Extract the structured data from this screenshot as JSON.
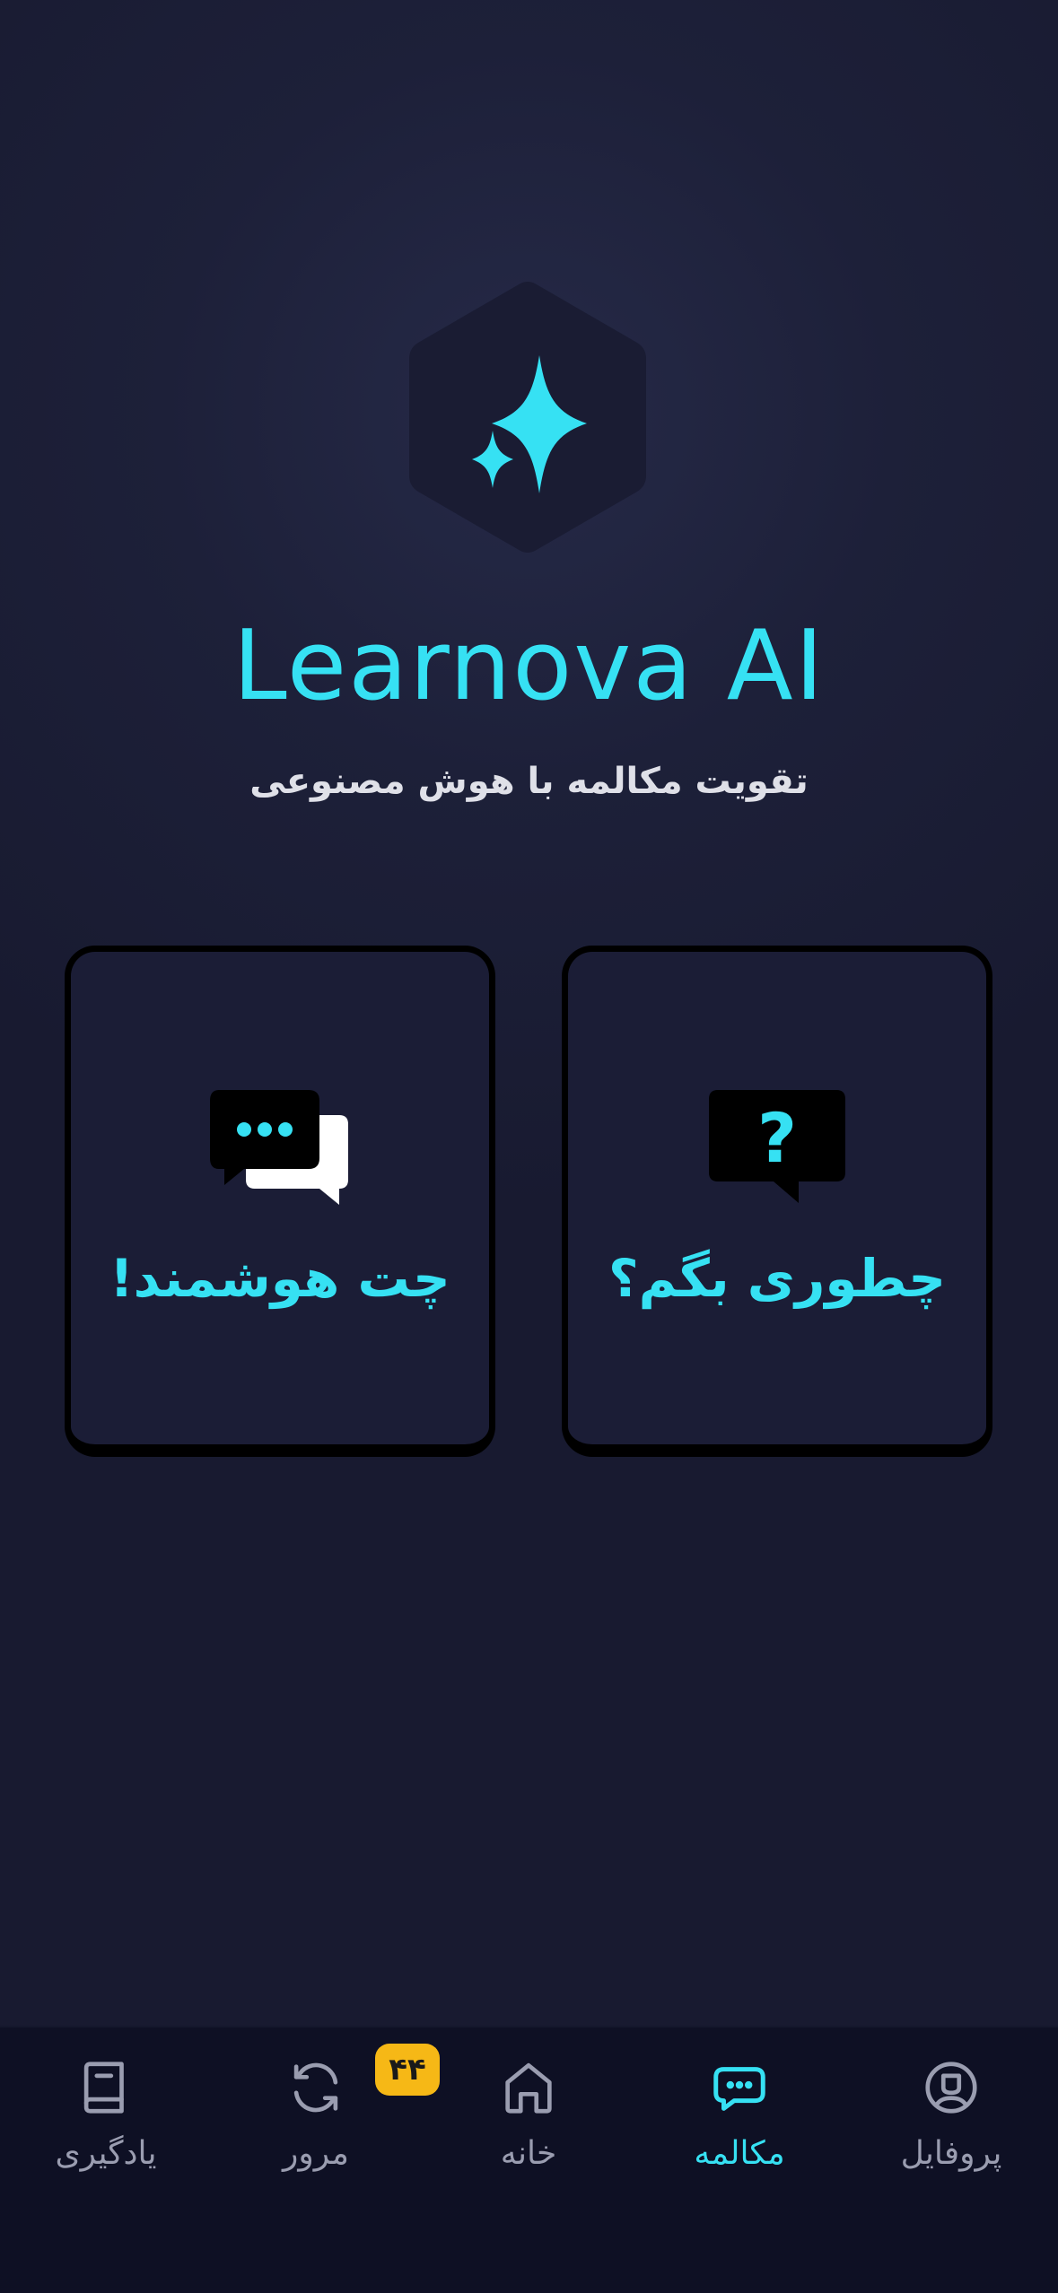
{
  "app": {
    "title": "Learnova AI",
    "subtitle": "تقویت مکالمه با هوش مصنوعی",
    "accent_color": "#36e1f3"
  },
  "cards": [
    {
      "id": "how-to-say",
      "label": "چطوری بگم؟",
      "icon": "question-bubble-icon"
    },
    {
      "id": "smart-chat",
      "label": "چت هوشمند!",
      "icon": "chat-bubbles-icon"
    }
  ],
  "nav": {
    "items": [
      {
        "id": "learning",
        "label": "یادگیری",
        "icon": "book-icon",
        "active": false
      },
      {
        "id": "review",
        "label": "مرور",
        "icon": "refresh-icon",
        "active": false,
        "badge": "۴۴"
      },
      {
        "id": "home",
        "label": "خانه",
        "icon": "home-icon",
        "active": false
      },
      {
        "id": "conversation",
        "label": "مکالمه",
        "icon": "chat-icon",
        "active": true
      },
      {
        "id": "profile",
        "label": "پروفایل",
        "icon": "profile-icon",
        "active": false
      }
    ],
    "badge_color": "#f6b816"
  }
}
